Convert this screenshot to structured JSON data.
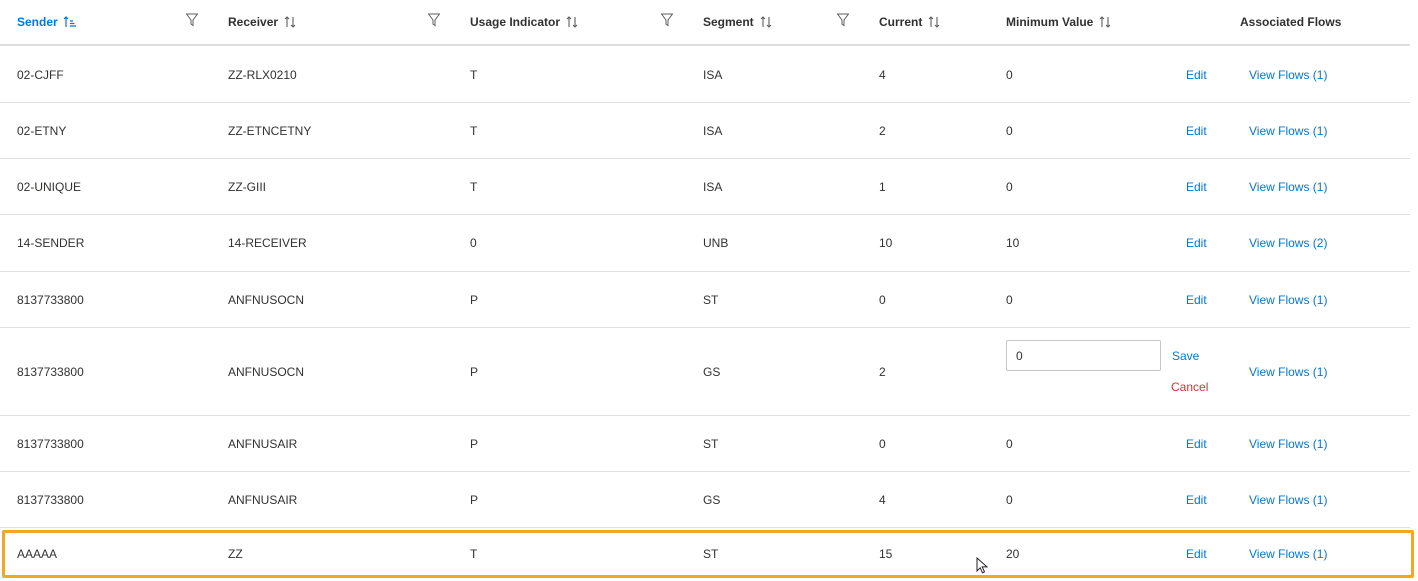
{
  "columns": {
    "sender": "Sender",
    "receiver": "Receiver",
    "usage": "Usage Indicator",
    "segment": "Segment",
    "current": "Current",
    "minimum": "Minimum Value",
    "flows": "Associated Flows"
  },
  "actions": {
    "edit": "Edit",
    "save": "Save",
    "cancel": "Cancel"
  },
  "colors": {
    "accent": "#0078d4",
    "highlight_border": "#f5a623",
    "cancel": "#d13438"
  },
  "rows": [
    {
      "sender": "02-CJFF",
      "receiver": "ZZ-RLX0210",
      "usage": "T",
      "segment": "ISA",
      "current": "4",
      "minimum": "0",
      "flows": "View Flows (1)"
    },
    {
      "sender": "02-ETNY",
      "receiver": "ZZ-ETNCETNY",
      "usage": "T",
      "segment": "ISA",
      "current": "2",
      "minimum": "0",
      "flows": "View Flows (1)"
    },
    {
      "sender": "02-UNIQUE",
      "receiver": "ZZ-GIII",
      "usage": "T",
      "segment": "ISA",
      "current": "1",
      "minimum": "0",
      "flows": "View Flows (1)"
    },
    {
      "sender": "14-SENDER",
      "receiver": "14-RECEIVER",
      "usage": "0",
      "segment": "UNB",
      "current": "10",
      "minimum": "10",
      "flows": "View Flows (2)"
    },
    {
      "sender": "8137733800",
      "receiver": "ANFNUSOCN",
      "usage": "P",
      "segment": "ST",
      "current": "0",
      "minimum": "0",
      "flows": "View Flows (1)"
    },
    {
      "sender": "8137733800",
      "receiver": "ANFNUSOCN",
      "usage": "P",
      "segment": "GS",
      "current": "2",
      "minimum": "0",
      "flows": "View Flows (1)"
    },
    {
      "sender": "8137733800",
      "receiver": "ANFNUSAIR",
      "usage": "P",
      "segment": "ST",
      "current": "0",
      "minimum": "0",
      "flows": "View Flows (1)"
    },
    {
      "sender": "8137733800",
      "receiver": "ANFNUSAIR",
      "usage": "P",
      "segment": "GS",
      "current": "4",
      "minimum": "0",
      "flows": "View Flows (1)"
    },
    {
      "sender": "AAAAA",
      "receiver": "ZZ",
      "usage": "T",
      "segment": "ST",
      "current": "15",
      "minimum": "20",
      "flows": "View Flows (1)"
    }
  ]
}
